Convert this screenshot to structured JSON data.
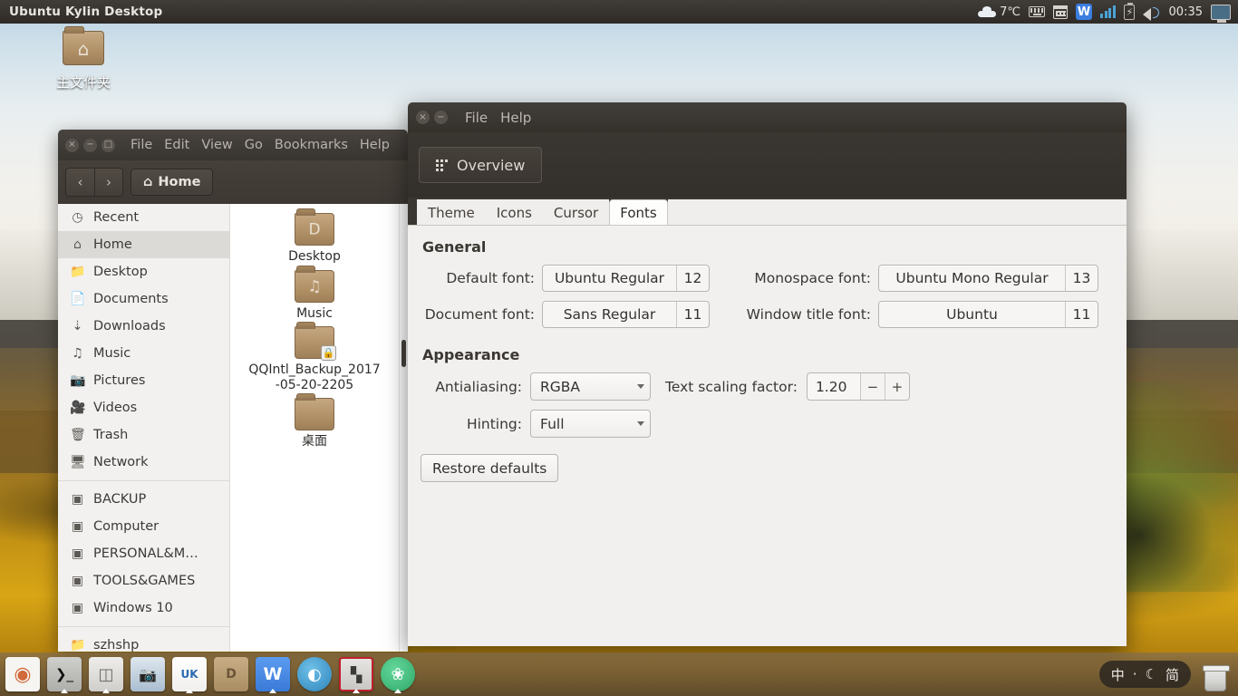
{
  "top_panel": {
    "title": "Ubuntu Kylin Desktop",
    "weather": {
      "icon": "cloud-icon",
      "temperature": "7℃"
    },
    "tray": [
      {
        "name": "keyboard-indicator-icon",
        "label": ""
      },
      {
        "name": "calendar-icon",
        "label": ""
      },
      {
        "name": "wps-office-icon",
        "label": "W"
      },
      {
        "name": "network-signal-icon",
        "label": ""
      },
      {
        "name": "battery-icon",
        "label": ""
      },
      {
        "name": "volume-icon",
        "label": ""
      }
    ],
    "clock": "00:35",
    "display_icon": "display-settings-icon"
  },
  "desktop": {
    "icons": [
      {
        "label": "主文件夹",
        "icon": "home-folder-icon"
      }
    ]
  },
  "file_manager": {
    "window_buttons": {
      "close": "×",
      "minimize": "−",
      "maximize": "□"
    },
    "menu": [
      "File",
      "Edit",
      "View",
      "Go",
      "Bookmarks",
      "Help"
    ],
    "nav": {
      "back": "‹",
      "forward": "›"
    },
    "path_button": {
      "icon": "home-icon",
      "label": "Home"
    },
    "sidebar": {
      "group1": [
        {
          "label": "Recent",
          "icon": "clock-icon",
          "active": false
        },
        {
          "label": "Home",
          "icon": "home-icon",
          "active": true
        },
        {
          "label": "Desktop",
          "icon": "desktop-folder-icon",
          "active": false
        },
        {
          "label": "Documents",
          "icon": "document-icon",
          "active": false
        },
        {
          "label": "Downloads",
          "icon": "download-icon",
          "active": false
        },
        {
          "label": "Music",
          "icon": "music-note-icon",
          "active": false
        },
        {
          "label": "Pictures",
          "icon": "camera-icon",
          "active": false
        },
        {
          "label": "Videos",
          "icon": "video-camera-icon",
          "active": false
        },
        {
          "label": "Trash",
          "icon": "trash-icon",
          "active": false
        },
        {
          "label": "Network",
          "icon": "network-icon",
          "active": false
        }
      ],
      "group2": [
        {
          "label": "BACKUP",
          "icon": "drive-icon"
        },
        {
          "label": "Computer",
          "icon": "drive-icon"
        },
        {
          "label": "PERSONAL&M…",
          "icon": "drive-icon"
        },
        {
          "label": "TOOLS&GAMES",
          "icon": "drive-icon"
        },
        {
          "label": "Windows 10",
          "icon": "drive-icon"
        }
      ],
      "group3": [
        {
          "label": "szhshp",
          "icon": "folder-icon"
        }
      ]
    },
    "files": [
      {
        "label": "Desktop",
        "icon": "folder-icon",
        "emblem": "D",
        "locked": false
      },
      {
        "label": "Music",
        "icon": "folder-icon",
        "emblem": "♫",
        "locked": false
      },
      {
        "label": "QQIntl_Backup_2017-05-20-2205",
        "icon": "folder-icon",
        "emblem": "",
        "locked": true
      },
      {
        "label": "桌面",
        "icon": "folder-icon",
        "emblem": "",
        "locked": false
      }
    ]
  },
  "settings": {
    "window_buttons": {
      "close": "×",
      "minimize": "−"
    },
    "menu": [
      "File",
      "Help"
    ],
    "overview_button": {
      "label": "Overview",
      "icon": "grid-icon"
    },
    "tabs": [
      {
        "label": "Theme",
        "active": false
      },
      {
        "label": "Icons",
        "active": false
      },
      {
        "label": "Cursor",
        "active": false
      },
      {
        "label": "Fonts",
        "active": true
      }
    ],
    "general": {
      "title": "General",
      "default_font": {
        "label": "Default font:",
        "value": "Ubuntu Regular",
        "size": "12"
      },
      "monospace_font": {
        "label": "Monospace font:",
        "value": "Ubuntu Mono Regular",
        "size": "13"
      },
      "document_font": {
        "label": "Document font:",
        "value": "Sans Regular",
        "size": "11"
      },
      "window_title_font": {
        "label": "Window title font:",
        "value": "Ubuntu",
        "size": "11"
      }
    },
    "appearance": {
      "title": "Appearance",
      "antialiasing": {
        "label": "Antialiasing:",
        "value": "RGBA"
      },
      "hinting": {
        "label": "Hinting:",
        "value": "Full"
      },
      "text_scaling": {
        "label": "Text scaling factor:",
        "value": "1.20",
        "minus": "−",
        "plus": "+"
      },
      "restore_defaults": "Restore defaults"
    }
  },
  "dock": {
    "items": [
      {
        "name": "ubuntu-kylin-start-icon",
        "glyph": "◉",
        "color": "#f6f5f2",
        "text": "#d1693a",
        "running": false
      },
      {
        "name": "terminal-icon",
        "glyph": "⌫",
        "color": "#c9c9c6",
        "text": "#1d1d1d",
        "running": true
      },
      {
        "name": "file-manager-icon",
        "glyph": "▤",
        "color": "#e4e2df",
        "text": "#6c6a66",
        "running": true
      },
      {
        "name": "screenshot-tool-icon",
        "glyph": "▣",
        "color": "#cfd6de",
        "text": "#46566b",
        "running": false
      },
      {
        "name": "ubuntu-kylin-software-center-icon",
        "glyph": "UK",
        "color": "#f2f2f0",
        "text": "#2a6ab0",
        "running": true
      },
      {
        "name": "desktop-folder-icon",
        "glyph": "D",
        "color": "#c2a67e",
        "text": "#6b5537",
        "running": false
      },
      {
        "name": "wps-writer-icon",
        "glyph": "W",
        "color": "#4a8ae6",
        "text": "#ffffff",
        "running": true
      },
      {
        "name": "browser-icon",
        "glyph": "◔",
        "color": "#3f9ad4",
        "text": "#ffffff",
        "running": false
      },
      {
        "name": "system-monitor-icon",
        "glyph": "‖",
        "color": "#d9d9d6",
        "text": "#3a3a38",
        "running": true
      },
      {
        "name": "unity-tweak-tool-icon",
        "glyph": "❀",
        "color": "#3fbf7f",
        "text": "#ffffff",
        "running": true
      }
    ],
    "ime": {
      "mode": "中",
      "dot": "·",
      "moon": "☾",
      "script": "简"
    },
    "trash": {
      "name": "trash-icon"
    }
  }
}
